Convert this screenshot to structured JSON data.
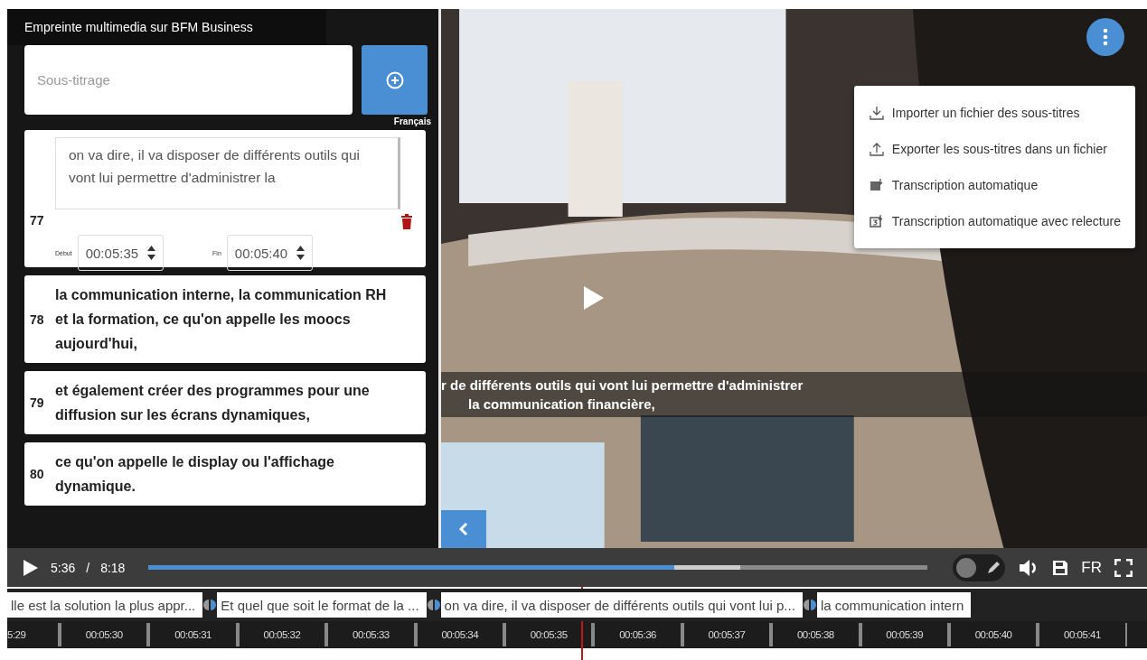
{
  "panel": {
    "title": "Empreinte multimedia sur BFM Business",
    "search": {
      "placeholder": "Sous-titrage"
    },
    "language": "Français"
  },
  "subtitles": [
    {
      "kind": "edit",
      "number": "77",
      "text": "on va dire, il va disposer de différents outils qui vont lui permettre d'administrer la",
      "start_label": "Début",
      "start": "00:05:35",
      "end_label": "Fin",
      "end": "00:05:40"
    },
    {
      "kind": "text",
      "number": "78",
      "text": "la communication interne, la communication RH et la formation, ce qu'on appelle les moocs aujourd'hui,"
    },
    {
      "kind": "text",
      "number": "79",
      "text": "et également créer des programmes pour une diffusion sur les écrans dynamiques,"
    },
    {
      "kind": "text",
      "number": "80",
      "text": "ce qu'on appelle le display ou l'affichage dynamique."
    }
  ],
  "video": {
    "caption_lines": [
      "r de différents outils qui vont lui permettre d'administrer",
      "la communication financière,"
    ]
  },
  "menu": {
    "items": [
      {
        "kind": "import",
        "label": "Importer un fichier des sous-titres"
      },
      {
        "kind": "export",
        "label": "Exporter les sous-titres dans un fichier"
      },
      {
        "kind": "auto",
        "label": "Transcription automatique"
      },
      {
        "kind": "review",
        "label": "Transcription automatique avec relecture"
      }
    ]
  },
  "controls": {
    "current": "5:36",
    "separator": "/",
    "duration": "8:18",
    "level": 0.675,
    "buffer": {
      "level": 0.76
    },
    "edit_mode": {
      "on": false
    },
    "language": "FR"
  },
  "timeline": {
    "segments": [
      {
        "text": "lle est la solution la plus appr..."
      },
      {
        "text": "Et quel que soit le format de la ..."
      },
      {
        "text": "on va dire, il va disposer de différents outils qui vont lui p..."
      },
      {
        "text": "la communication intern"
      }
    ],
    "ticks": [
      "5:29",
      "00:05:30",
      "00:05:31",
      "00:05:32",
      "00:05:33",
      "00:05:34",
      "00:05:35",
      "00:05:36",
      "00:05:37",
      "00:05:38",
      "00:05:39",
      "00:05:40",
      "00:05:41"
    ]
  }
}
